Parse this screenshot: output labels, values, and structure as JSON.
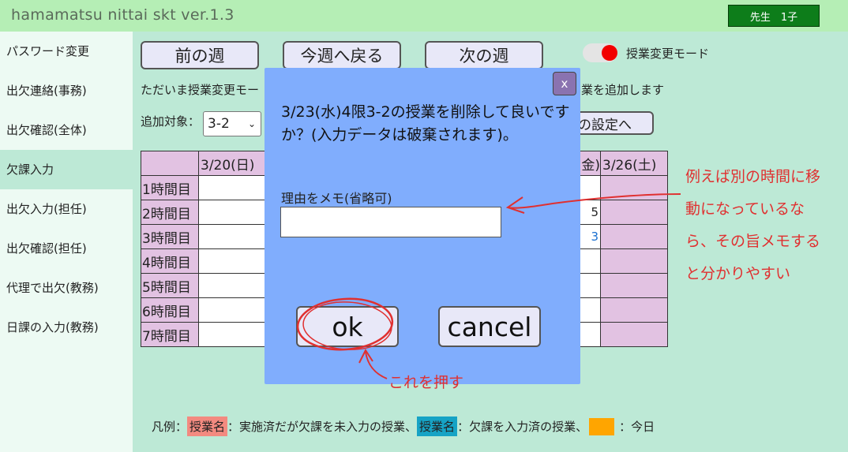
{
  "header": {
    "app_title": "hamamatsu nittai skt ver.1.3",
    "user_badge": "先生　1子"
  },
  "sidebar": {
    "items": [
      {
        "label": "パスワード変更"
      },
      {
        "label": "出欠連絡(事務)"
      },
      {
        "label": "出欠確認(全体)"
      },
      {
        "label": "欠課入力"
      },
      {
        "label": "出欠入力(担任)"
      },
      {
        "label": "出欠確認(担任)"
      },
      {
        "label": "代理で出欠(教務)"
      },
      {
        "label": "日課の入力(教務)"
      }
    ],
    "active_index": 3
  },
  "week_nav": {
    "prev_label": "前の週",
    "current_label": "今週へ戻る",
    "next_label": "次の週"
  },
  "mode_toggle": {
    "label": "授業変更モード",
    "on": true
  },
  "info": {
    "text_left": "ただいま授業変更モー",
    "text_right": "業を追加します"
  },
  "target": {
    "label": "追加対象：",
    "selected": "3-2",
    "settings_button": "の設定へ"
  },
  "timetable": {
    "headers": [
      "3/20(日)",
      "金)",
      "3/26(土)"
    ],
    "periods": [
      "1時間目",
      "2時間目",
      "3時間目",
      "4時間目",
      "5時間目",
      "6時間目",
      "7時間目"
    ],
    "partial_values": {
      "row2": "5",
      "row3": "3"
    }
  },
  "legend": {
    "prefix": "凡例：",
    "item1_name": "授業名",
    "item1_desc": "：実施済だが欠課を未入力の授業、",
    "item2_name": "授業名",
    "item2_desc": "：欠課を入力済の授業、",
    "item3_desc": "：今日"
  },
  "dialog": {
    "close_label": "x",
    "message": "3/23(水)4限3-2の授業を削除して良いですか？(入力データは破棄されます)。",
    "memo_label": "理由をメモ(省略可)",
    "memo_value": "",
    "ok_label": "ok",
    "cancel_label": "cancel"
  },
  "annotations": {
    "side_note": "例えば別の時間に移動になっているなら、その旨メモすると分かりやすい",
    "push_note": "これを押す"
  },
  "colors": {
    "annotation": "#e03030",
    "dialog_bg": "#80adfd",
    "toggle_on": "#f20000"
  }
}
